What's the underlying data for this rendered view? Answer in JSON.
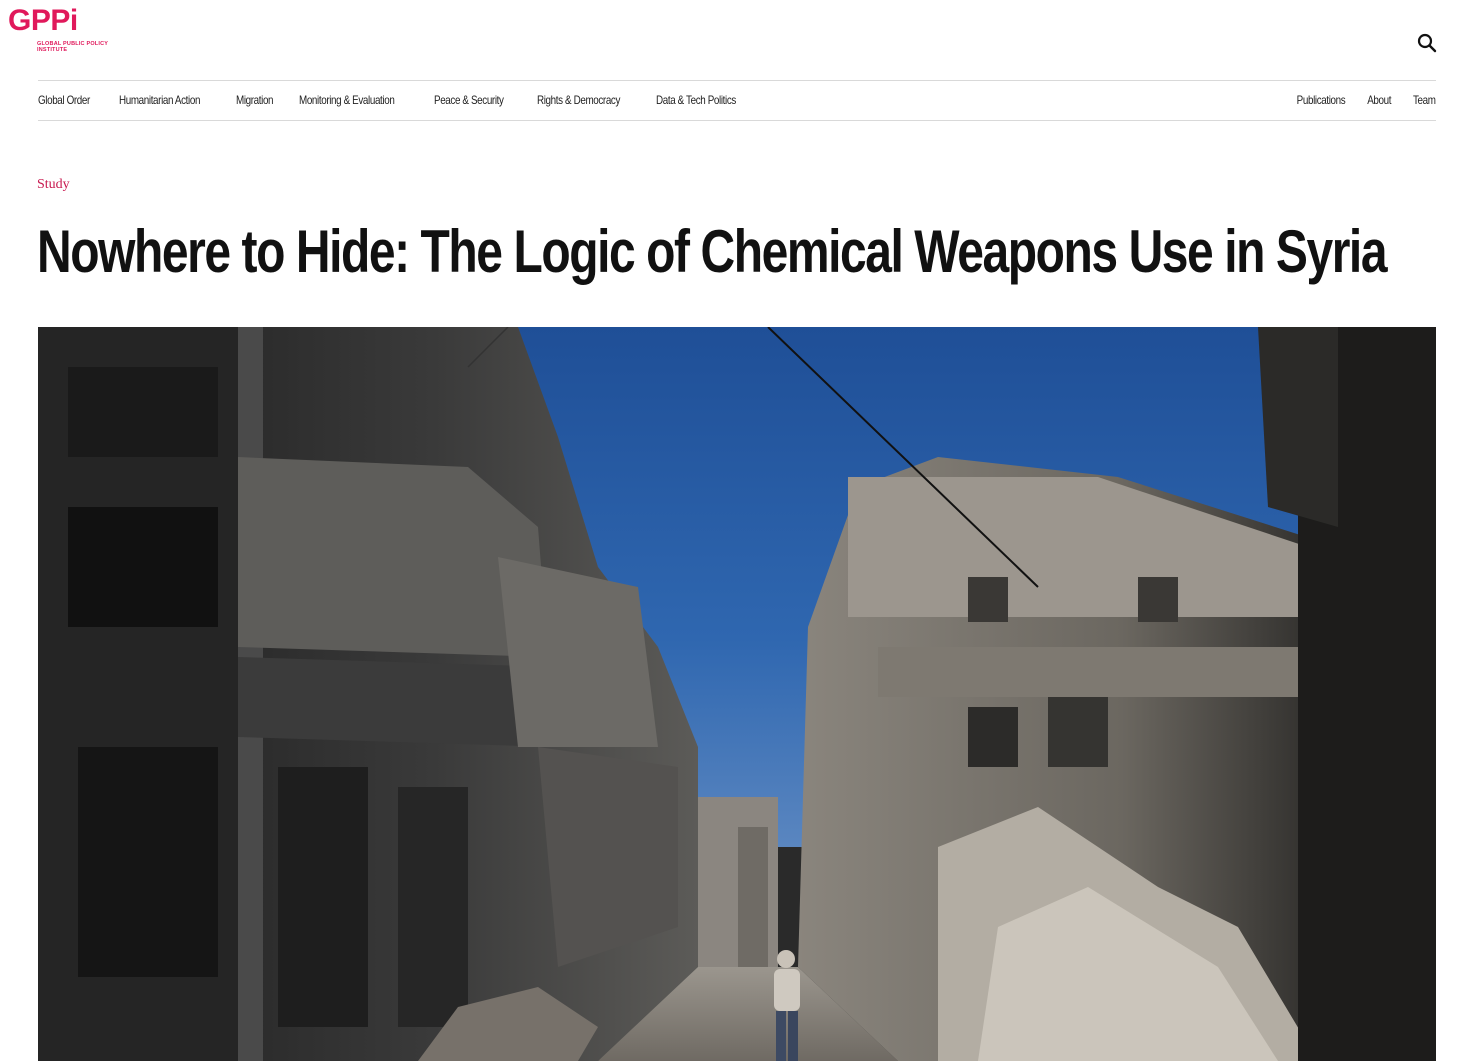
{
  "brand": {
    "name": "GPPi",
    "subtitle": "GLOBAL PUBLIC POLICY INSTITUTE",
    "accent_color": "#e0195b"
  },
  "header": {
    "search_icon": "search-icon"
  },
  "nav": {
    "primary": [
      {
        "label": "Global Order"
      },
      {
        "label": "Humanitarian Action"
      },
      {
        "label": "Migration"
      },
      {
        "label": "Monitoring & Evaluation"
      },
      {
        "label": "Peace & Security"
      },
      {
        "label": "Rights & Democracy"
      },
      {
        "label": "Data & Tech Politics"
      }
    ],
    "secondary": [
      {
        "label": "Publications"
      },
      {
        "label": "About"
      },
      {
        "label": "Team"
      }
    ]
  },
  "article": {
    "kicker": "Study",
    "title": "Nowhere to Hide: The Logic of Chemical Weapons Use in Syria"
  }
}
